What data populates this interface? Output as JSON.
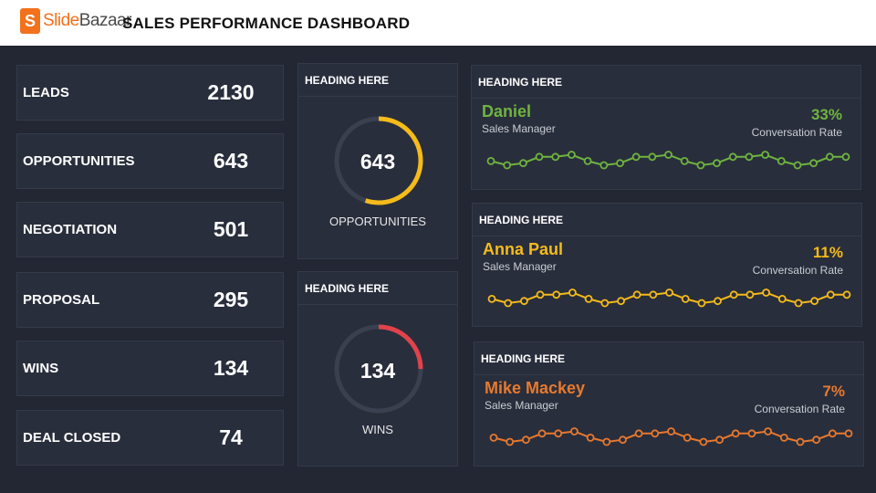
{
  "header": {
    "logo_initial": "S",
    "logo_part1": "Slide",
    "logo_part2": "Bazaar",
    "title": "SALES PERFORMANCE DASHBOARD"
  },
  "stats": [
    {
      "label": "LEADS",
      "value": "2130"
    },
    {
      "label": "OPPORTUNITIES",
      "value": "643"
    },
    {
      "label": "NEGOTIATION",
      "value": "501"
    },
    {
      "label": "PROPOSAL",
      "value": "295"
    },
    {
      "label": "WINS",
      "value": "134"
    },
    {
      "label": "DEAL CLOSED",
      "value": "74"
    }
  ],
  "gauges": [
    {
      "heading": "HEADING HERE",
      "value": "643",
      "label": "OPPORTUNITIES",
      "fraction": 0.55,
      "color": "#f5bb1a"
    },
    {
      "heading": "HEADING HERE",
      "value": "134",
      "label": "WINS",
      "fraction": 0.25,
      "color": "#e0434b"
    }
  ],
  "people": [
    {
      "heading": "HEADING HERE",
      "name": "Daniel",
      "role": "Sales Manager",
      "rate": "33%",
      "rate_label": "Conversation Rate",
      "color": "#6fb43f"
    },
    {
      "heading": "HEADING HERE",
      "name": "Anna Paul",
      "role": "Sales Manager",
      "rate": "11%",
      "rate_label": "Conversation Rate",
      "color": "#f5bb1a"
    },
    {
      "heading": "HEADING HERE",
      "name": "Mike Mackey",
      "role": "Sales Manager",
      "rate": "7%",
      "rate_label": "Conversation Rate",
      "color": "#e8792e"
    }
  ],
  "sparkline_values": [
    2,
    0,
    1,
    4,
    4,
    5,
    2,
    0,
    1,
    4,
    4,
    5,
    2,
    0,
    1,
    4,
    4,
    5,
    2,
    0,
    1,
    4,
    4
  ]
}
